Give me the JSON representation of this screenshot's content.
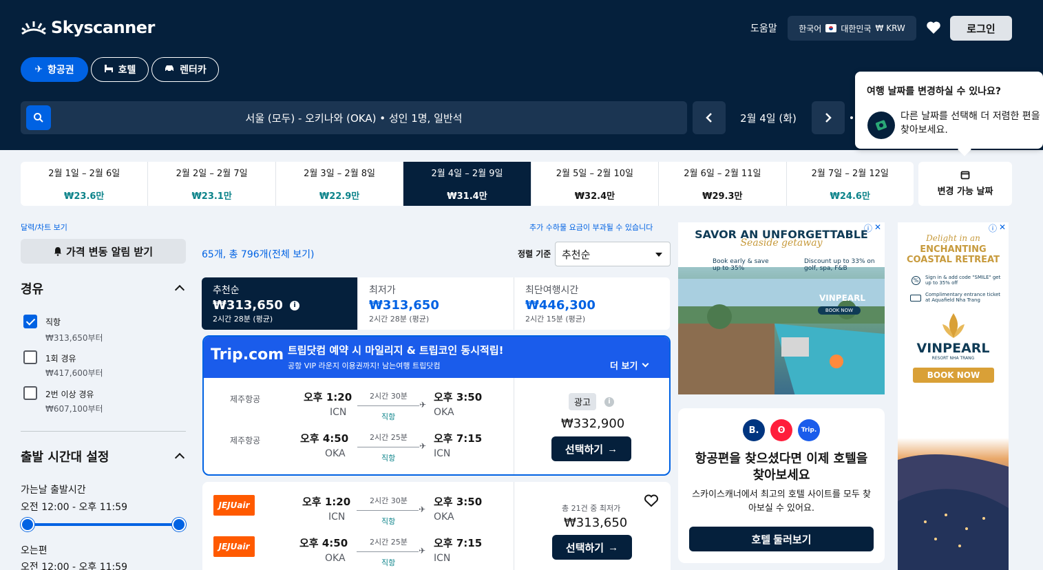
{
  "header": {
    "logo_text": "Skyscanner",
    "help": "도움말",
    "locale": {
      "language": "한국어",
      "country": "대한민국",
      "currency": "₩ KRW"
    },
    "login": "로그인"
  },
  "nav_pills": [
    {
      "label": "항공권",
      "icon": "plane-icon",
      "active": true
    },
    {
      "label": "호텔",
      "icon": "bed-icon",
      "active": false
    },
    {
      "label": "렌터카",
      "icon": "car-icon",
      "active": false
    }
  ],
  "search": {
    "summary": "서울 (모두) - 오키나와 (OKA)  •  성인 1명, 일반석",
    "date": "2월 4일 (화)"
  },
  "tooltip": {
    "title": "여행 날짜를 변경하실 수 있나요?",
    "body": "다른 날짜를 선택해 더 저렴한 편을 찾아보세요."
  },
  "date_strip": [
    {
      "dates": "2월 1일 – 2월 6일",
      "price": "₩23.6만",
      "cheap": true
    },
    {
      "dates": "2월 2일 – 2월 7일",
      "price": "₩23.1만",
      "cheap": true
    },
    {
      "dates": "2월 3일 – 2월 8일",
      "price": "₩22.9만",
      "cheap": true
    },
    {
      "dates": "2월 4일 – 2월 9일",
      "price": "₩31.4만",
      "cheap": false,
      "selected": true
    },
    {
      "dates": "2월 5일 – 2월 10일",
      "price": "₩32.4만",
      "cheap": false
    },
    {
      "dates": "2월 6일 – 2월 11일",
      "price": "₩29.3만",
      "cheap": false
    },
    {
      "dates": "2월 7일 – 2월 12일",
      "price": "₩24.6만",
      "cheap": true
    }
  ],
  "flexible_dates": "변경 가능 날짜",
  "sidebar": {
    "calendar_link": "달력/차트 보기",
    "price_alert": "가격 변동 알림 받기",
    "stops_title": "경유",
    "stops": [
      {
        "label": "직항",
        "sub": "₩313,650부터",
        "checked": true
      },
      {
        "label": "1회 경유",
        "sub": "₩417,600부터",
        "checked": false
      },
      {
        "label": "2번 이상 경유",
        "sub": "₩607,100부터",
        "checked": false
      }
    ],
    "departure_title": "출발 시간대 설정",
    "outbound_label": "가는날 출발시간",
    "outbound_range": "오전 12:00 - 오후 11:59",
    "return_label": "오는편",
    "return_range": "오전 12:00 - 오후 11:59",
    "outbound_slider": {
      "min": 0.0,
      "max": 1.0
    }
  },
  "results": {
    "count_text": "65개, 총 796개(전체 보기)",
    "extra_fee": "추가 수하물 요금이 부과될 수 있습니다",
    "sort_label": "정렬 기준",
    "sort_value": "추천순"
  },
  "sort_tabs": [
    {
      "title": "추천순",
      "price": "₩313,650",
      "duration": "2시간 28분 (평균)",
      "selected": true
    },
    {
      "title": "최저가",
      "price": "₩313,650",
      "duration": "2시간 28분 (평균)",
      "selected": false
    },
    {
      "title": "최단여행시간",
      "price": "₩446,300",
      "duration": "2시간 15분 (평균)",
      "selected": false
    }
  ],
  "sponsored": {
    "brand": "Trip.com",
    "headline": "트립닷컴 예약 시 마일리지 & 트립코인 동시적립!",
    "subline": "공항 VIP 라운지 이용권까지! 남는여행 트립닷컴",
    "more": "더 보기",
    "ad_badge": "광고",
    "price": "₩332,900",
    "select": "선택하기",
    "legs": [
      {
        "airline": "제주항공",
        "dep_time": "오후 1:20",
        "dep_code": "ICN",
        "duration": "2시간 30분",
        "stops": "직항",
        "arr_time": "오후 3:50",
        "arr_code": "OKA"
      },
      {
        "airline": "제주항공",
        "dep_time": "오후 4:50",
        "dep_code": "OKA",
        "duration": "2시간 25분",
        "stops": "직항",
        "arr_time": "오후 7:15",
        "arr_code": "ICN"
      }
    ]
  },
  "result2": {
    "logo": "JEJUair",
    "deals_text": "총 21건 중 최저가",
    "price": "₩313,650",
    "select": "선택하기",
    "legs": [
      {
        "dep_time": "오후 1:20",
        "dep_code": "ICN",
        "duration": "2시간 30분",
        "stops": "직항",
        "arr_time": "오후 3:50",
        "arr_code": "OKA"
      },
      {
        "dep_time": "오후 4:50",
        "dep_code": "OKA",
        "duration": "2시간 25분",
        "stops": "직항",
        "arr_time": "오후 7:15",
        "arr_code": "ICN"
      }
    ]
  },
  "ad_vinpearl_1": {
    "title": "SAVOR AN UNFORGETTABLE",
    "script": "Seaside getaway",
    "offer1": "Book early & save up to 35%",
    "offer2": "Discount up to 33% on golf, spa, F&B",
    "brand": "VINPEARL",
    "cta": "BOOK NOW"
  },
  "hotel_promo": {
    "logos": [
      "B.",
      "ʘ",
      "Trip."
    ],
    "title": "항공편을 찾으셨다면 이제 호텔을 찾아보세요",
    "desc": "스카이스캐너에서 최고의 호텔 사이트를 모두 찾아보실 수 있어요.",
    "cta": "호텔 둘러보기"
  },
  "ad_vinpearl_2": {
    "script": "Delight in an",
    "title": "ENCHANTING COASTAL RETREAT",
    "offer1": "Sign in & add code \"SMILE\" get up to 35% off",
    "offer2": "Complimentary entrance ticket at Aquafield Nha Trang",
    "brand": "VINPEARL",
    "brand_sub": "RESORT NHA TRANG",
    "cta": "BOOK NOW"
  },
  "colors": {
    "navy": "#05203c",
    "blue": "#0062e3",
    "teal": "#0c838a",
    "jeju_orange": "#ff5a00",
    "trip_blue": "#1a5ceb"
  }
}
